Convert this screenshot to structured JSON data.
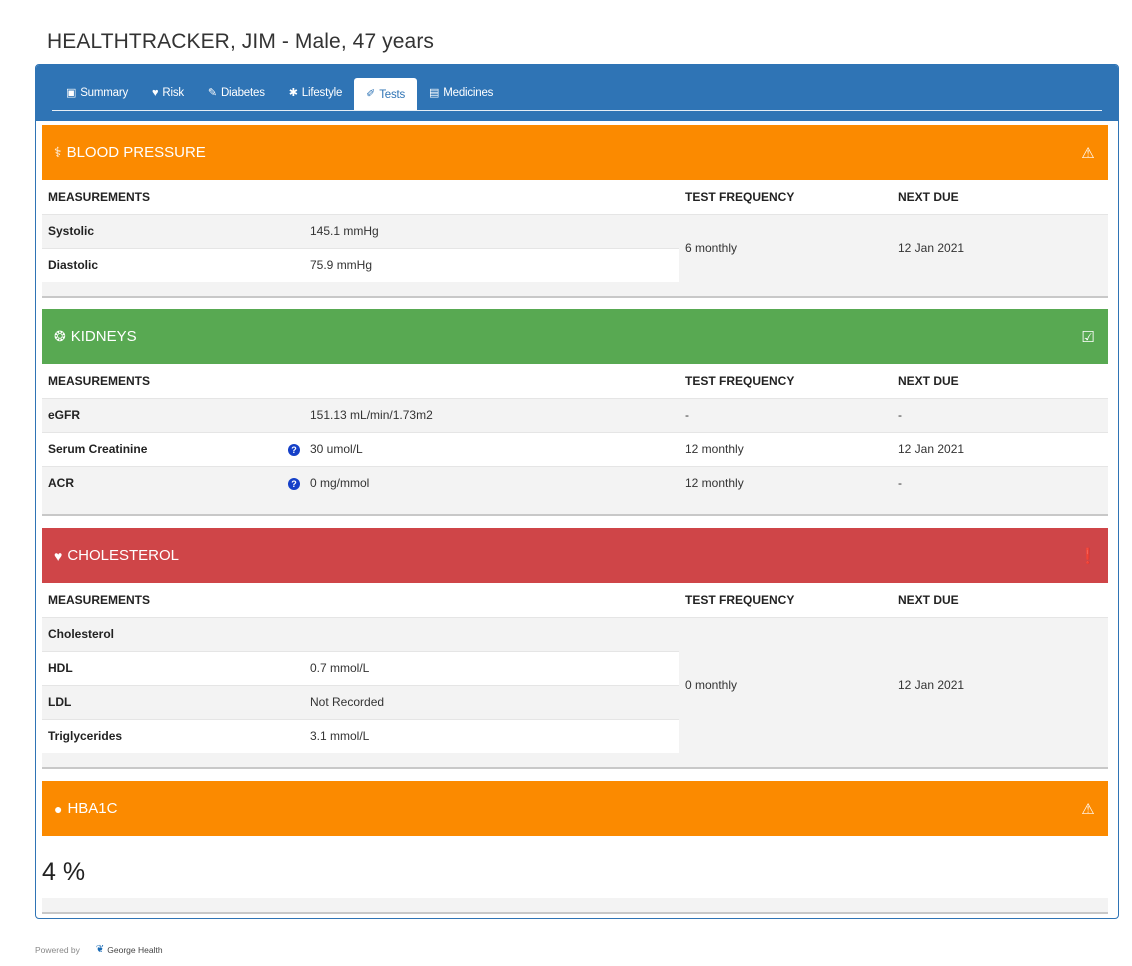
{
  "patient": {
    "title": "HEALTHTRACKER, JIM - Male, 47 years"
  },
  "tabs": [
    {
      "label": "Summary",
      "icon": "clipboard-icon",
      "glyph": "▣",
      "active": false
    },
    {
      "label": "Risk",
      "icon": "heart-icon",
      "glyph": "♥",
      "active": false
    },
    {
      "label": "Diabetes",
      "icon": "pencil-icon",
      "glyph": "✎",
      "active": false
    },
    {
      "label": "Lifestyle",
      "icon": "running-icon",
      "glyph": "✱",
      "active": false
    },
    {
      "label": "Tests",
      "icon": "pen-icon",
      "glyph": "✐",
      "active": true
    },
    {
      "label": "Medicines",
      "icon": "pill-bottle-icon",
      "glyph": "▤",
      "active": false
    }
  ],
  "colors": {
    "tab_bar": "#2f74b5",
    "warning": "#fb8a00",
    "ok": "#58a952",
    "alert": "#cf4548"
  },
  "headers": {
    "measurements": "MEASUREMENTS",
    "test_frequency": "TEST FREQUENCY",
    "next_due": "NEXT DUE"
  },
  "blood_pressure": {
    "title": "BLOOD PRESSURE",
    "icon": "stethoscope-icon",
    "status_icon": "warning-icon",
    "rows": [
      {
        "label": "Systolic",
        "value": "145.1 mmHg"
      },
      {
        "label": "Diastolic",
        "value": "75.9 mmHg"
      }
    ],
    "frequency": "6 monthly",
    "next_due": "12 Jan 2021"
  },
  "kidneys": {
    "title": "KIDNEYS",
    "icon": "kidneys-icon",
    "status_icon": "check-square-icon",
    "rows": [
      {
        "label": "eGFR",
        "value": "151.13 mL/min/1.73m2",
        "frequency": "-",
        "next_due": "-"
      },
      {
        "label": "Serum Creatinine",
        "value": "30 umol/L",
        "frequency": "12 monthly",
        "next_due": "12 Jan 2021"
      },
      {
        "label": "ACR",
        "value": "0 mg/mmol",
        "frequency": "12 monthly",
        "next_due": "-"
      }
    ]
  },
  "cholesterol": {
    "title": "CHOLESTEROL",
    "icon": "heart-icon",
    "status_icon": "exclamation-circle-icon",
    "rows": [
      {
        "label": "Cholesterol",
        "value": ""
      },
      {
        "label": "HDL",
        "value": "0.7 mmol/L"
      },
      {
        "label": "LDL",
        "value": "Not Recorded"
      },
      {
        "label": "Triglycerides",
        "value": "3.1 mmol/L"
      }
    ],
    "frequency": "0 monthly",
    "next_due": "12 Jan 2021"
  },
  "hba1c": {
    "title": "HBA1C",
    "icon": "droplet-icon",
    "status_icon": "warning-icon",
    "value": "4 %"
  },
  "footer": {
    "powered_by": "Powered by",
    "brand": "George Health"
  }
}
